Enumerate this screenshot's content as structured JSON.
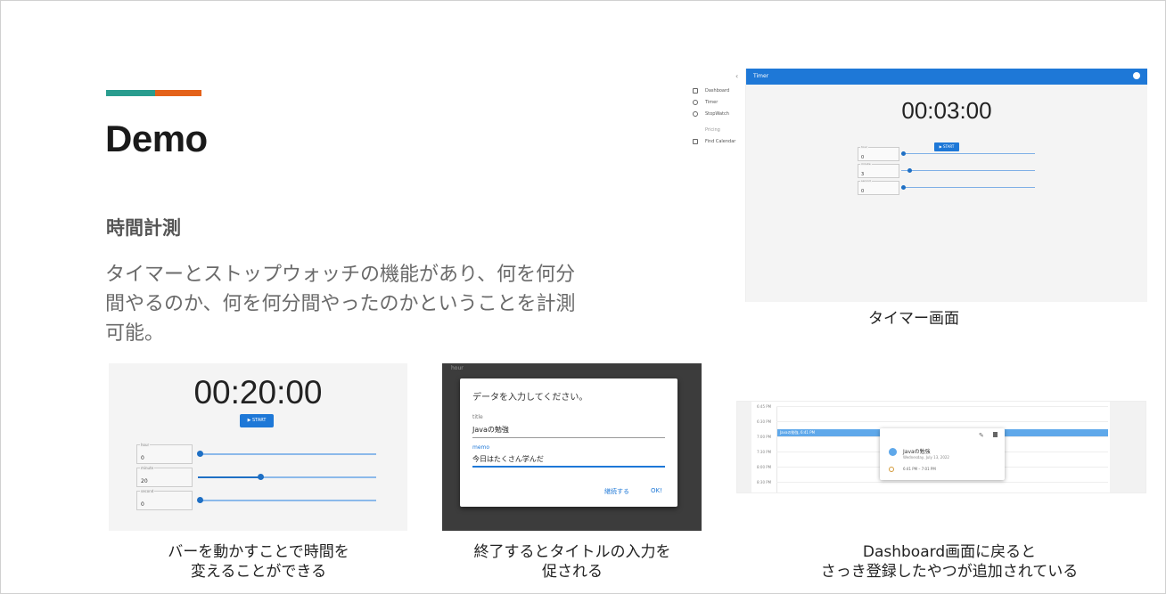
{
  "slide": {
    "title": "Demo",
    "subtitle": "時間計測",
    "description": "タイマーとストップウォッチの機能があり、何を何分間やるのか、何を何分間やったのかということを計測可能。",
    "accent_colors": [
      "#2a9d8f",
      "#e4621a"
    ]
  },
  "timer_screen": {
    "caption": "タイマー画面",
    "header_title": "Timer",
    "nav_items": [
      "Dashboard",
      "Timer",
      "StopWatch",
      "Pricing",
      "Find Calendar"
    ],
    "time": "00:03:00",
    "start_label": "START",
    "fields": [
      {
        "label": "hour",
        "value": "0",
        "slider_fraction": 0.0
      },
      {
        "label": "minute",
        "value": "3",
        "slider_fraction": 0.05
      },
      {
        "label": "second",
        "value": "0",
        "slider_fraction": 0.0
      }
    ]
  },
  "slider_demo": {
    "caption_line1": "バーを動かすことで時間を",
    "caption_line2": "変えることができる",
    "time": "00:20:00",
    "start_label": "START",
    "fields": [
      {
        "label": "hour",
        "value": "0",
        "slider_fraction": 0.0
      },
      {
        "label": "minute",
        "value": "20",
        "slider_fraction": 0.34
      },
      {
        "label": "second",
        "value": "0",
        "slider_fraction": 0.0
      }
    ]
  },
  "dialog_demo": {
    "caption_line1": "終了するとタイトルの入力を",
    "caption_line2": "促される",
    "background_label": "hour",
    "heading": "データを入力してください。",
    "title_label": "title",
    "title_value": "Javaの勉強",
    "memo_label": "memo",
    "memo_value": "今日はたくさん学んだ",
    "continue_label": "継続する",
    "ok_label": "OK!"
  },
  "calendar_demo": {
    "caption_line1": "Dashboard画面に戻ると",
    "caption_line2": "さっき登録したやつが追加されている",
    "times": [
      "6:45 PM",
      "6:30 PM",
      "7:00 PM",
      "7:30 PM",
      "8:00 PM",
      "8:30 PM"
    ],
    "event_label": "Javaの勉強, 6:41 PM",
    "event_title": "Javaの勉強",
    "event_date": "Wednesday, July 13, 2022",
    "event_range": "6:41 PM – 7:01 PM",
    "event_color": "#5fa8ea"
  }
}
